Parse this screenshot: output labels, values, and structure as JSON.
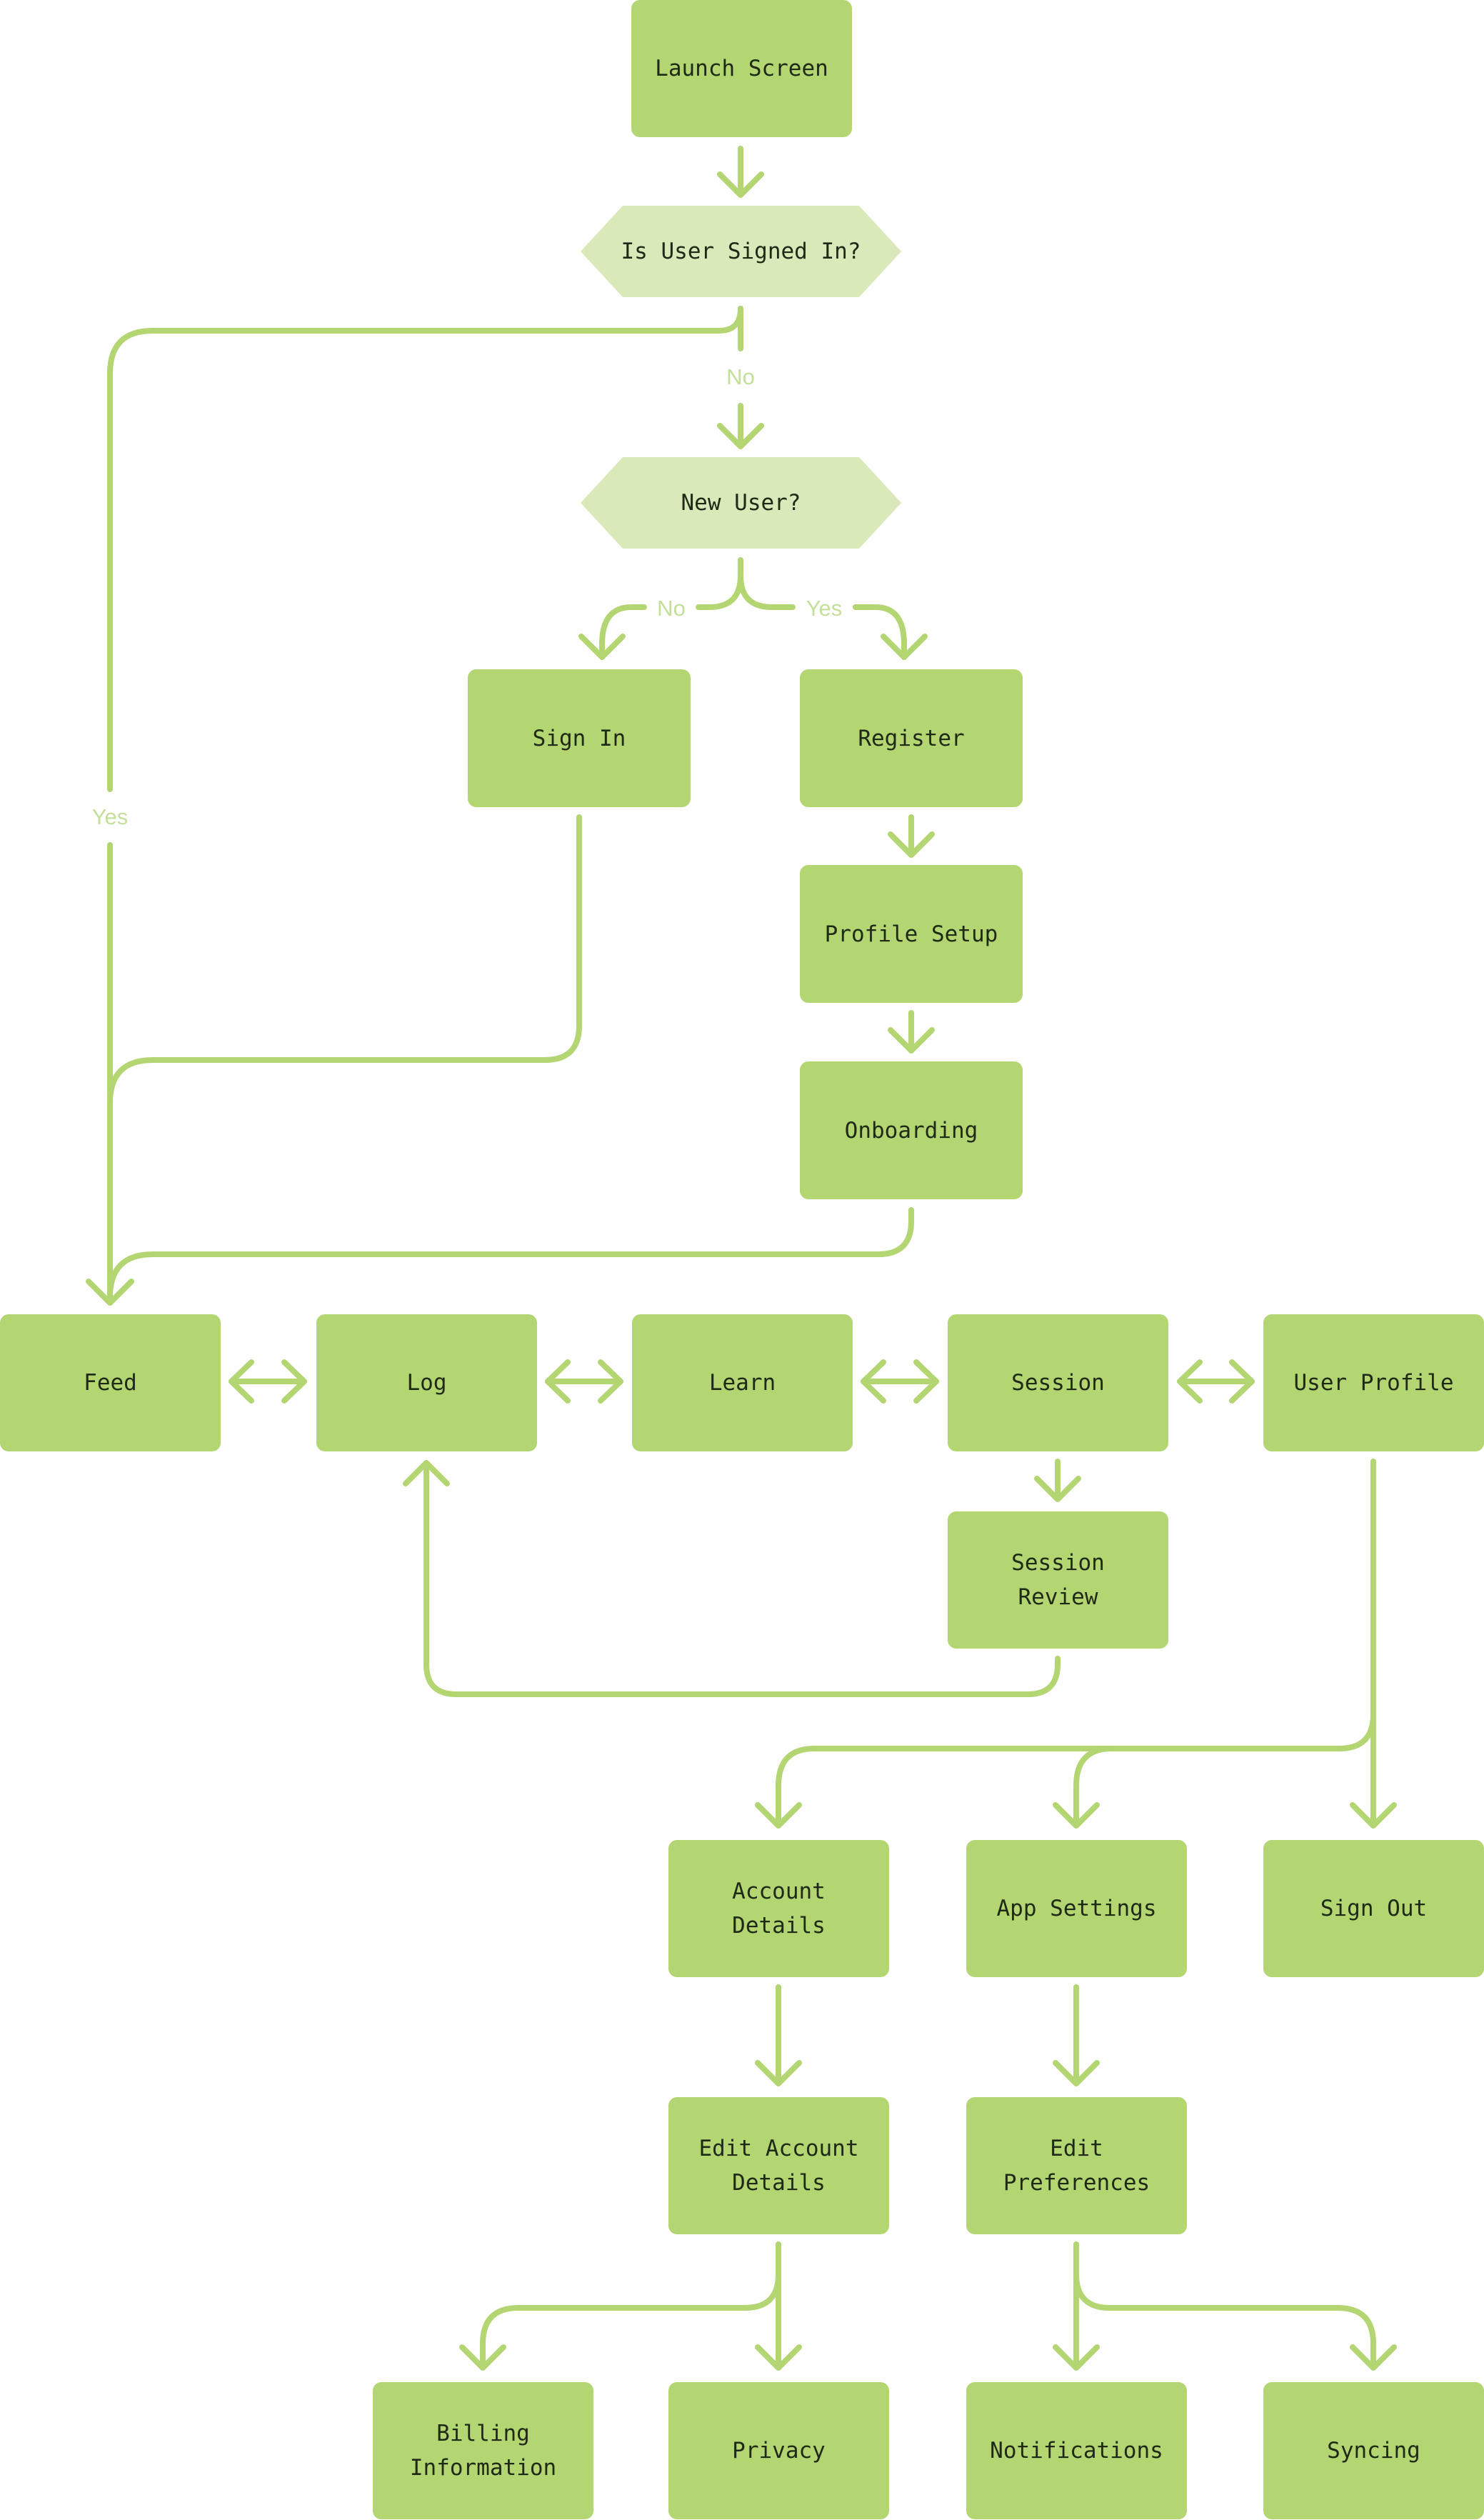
{
  "colors": {
    "box_fill": "#b3d572",
    "decision_fill": "#d9e9b9",
    "connector": "#b3d572",
    "edge_label": "#c3df98",
    "text": "#1f2a16"
  },
  "nodes": {
    "launch_screen": "Launch Screen",
    "is_user_signed_in": "Is User Signed In?",
    "new_user": "New User?",
    "sign_in": "Sign In",
    "register": "Register",
    "profile_setup": "Profile Setup",
    "onboarding": "Onboarding",
    "feed": "Feed",
    "log": "Log",
    "learn": "Learn",
    "session": "Session",
    "user_profile": "User Profile",
    "session_review": "Session Review",
    "account_details": "Account\nDetails",
    "app_settings": "App Settings",
    "sign_out": "Sign Out",
    "edit_account_details": "Edit Account\nDetails",
    "edit_preferences": "Edit\nPreferences",
    "billing_information": "Billing\nInformation",
    "privacy": "Privacy",
    "notifications": "Notifications",
    "syncing": "Syncing"
  },
  "edge_labels": {
    "signed_in_no": "No",
    "signed_in_yes": "Yes",
    "new_user_no": "No",
    "new_user_yes": "Yes"
  },
  "edges": [
    {
      "from": "Launch Screen",
      "to": "Is User Signed In?"
    },
    {
      "from": "Is User Signed In?",
      "to": "New User?",
      "label": "No"
    },
    {
      "from": "Is User Signed In?",
      "to": "Feed",
      "label": "Yes"
    },
    {
      "from": "New User?",
      "to": "Sign In",
      "label": "No"
    },
    {
      "from": "New User?",
      "to": "Register",
      "label": "Yes"
    },
    {
      "from": "Sign In",
      "to": "Feed"
    },
    {
      "from": "Register",
      "to": "Profile Setup"
    },
    {
      "from": "Profile Setup",
      "to": "Onboarding"
    },
    {
      "from": "Onboarding",
      "to": "Feed"
    },
    {
      "from": "Feed",
      "to": "Log",
      "bidirectional": true
    },
    {
      "from": "Log",
      "to": "Learn",
      "bidirectional": true
    },
    {
      "from": "Learn",
      "to": "Session",
      "bidirectional": true
    },
    {
      "from": "Session",
      "to": "User Profile",
      "bidirectional": true
    },
    {
      "from": "Session",
      "to": "Session Review"
    },
    {
      "from": "Session Review",
      "to": "Log"
    },
    {
      "from": "User Profile",
      "to": "Account Details"
    },
    {
      "from": "User Profile",
      "to": "App Settings"
    },
    {
      "from": "User Profile",
      "to": "Sign Out"
    },
    {
      "from": "Account Details",
      "to": "Edit Account Details"
    },
    {
      "from": "App Settings",
      "to": "Edit Preferences"
    },
    {
      "from": "Edit Account Details",
      "to": "Billing Information"
    },
    {
      "from": "Edit Account Details",
      "to": "Privacy"
    },
    {
      "from": "Edit Preferences",
      "to": "Notifications"
    },
    {
      "from": "Edit Preferences",
      "to": "Syncing"
    }
  ]
}
